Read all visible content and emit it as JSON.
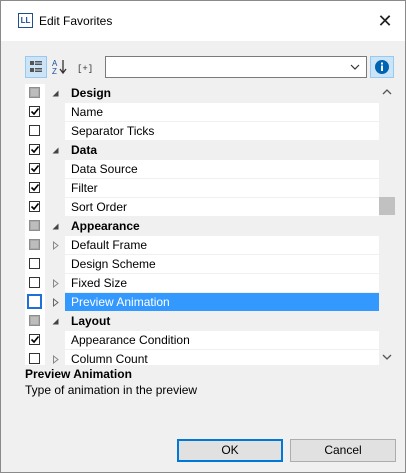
{
  "window": {
    "app_icon_text": "LL",
    "title": "Edit Favorites",
    "close_glyph": "✕"
  },
  "toolbar": {
    "categorized_icon": "categorized-icon",
    "alphabetical_icon": "sort-az-icon",
    "favorites_icon": "favorites-bracket-icon",
    "favorites_text": "[+]",
    "filter_value": "",
    "info_icon": "info-icon"
  },
  "colors": {
    "selection": "#3399ff",
    "focus": "#1e6fd9",
    "accent_info": "#0063b1"
  },
  "grid": {
    "rows": [
      {
        "label": "Design",
        "type": "category",
        "check": "indeterminate",
        "expander": "expanded"
      },
      {
        "label": "Name",
        "type": "property",
        "check": "checked",
        "expander": "none"
      },
      {
        "label": "Separator Ticks",
        "type": "property",
        "check": "unchecked",
        "expander": "none"
      },
      {
        "label": "Data",
        "type": "category",
        "check": "checked",
        "expander": "expanded"
      },
      {
        "label": "Data Source",
        "type": "property",
        "check": "checked",
        "expander": "none"
      },
      {
        "label": "Filter",
        "type": "property",
        "check": "checked",
        "expander": "none"
      },
      {
        "label": "Sort Order",
        "type": "property",
        "check": "checked",
        "expander": "none"
      },
      {
        "label": "Appearance",
        "type": "category",
        "check": "indeterminate",
        "expander": "expanded"
      },
      {
        "label": "Default Frame",
        "type": "property",
        "check": "indeterminate",
        "expander": "collapsed"
      },
      {
        "label": "Design Scheme",
        "type": "property",
        "check": "unchecked",
        "expander": "none"
      },
      {
        "label": "Fixed Size",
        "type": "property",
        "check": "unchecked",
        "expander": "collapsed"
      },
      {
        "label": "Preview Animation",
        "type": "property",
        "check": "unchecked",
        "expander": "collapsed",
        "selected": true
      },
      {
        "label": "Layout",
        "type": "category",
        "check": "indeterminate",
        "expander": "expanded"
      },
      {
        "label": "Appearance Condition",
        "type": "property",
        "check": "checked",
        "expander": "none"
      },
      {
        "label": "Column Count",
        "type": "property",
        "check": "unchecked",
        "expander": "collapsed"
      }
    ]
  },
  "description": {
    "title": "Preview Animation",
    "text": "Type of animation in the preview"
  },
  "buttons": {
    "ok": "OK",
    "cancel": "Cancel"
  }
}
